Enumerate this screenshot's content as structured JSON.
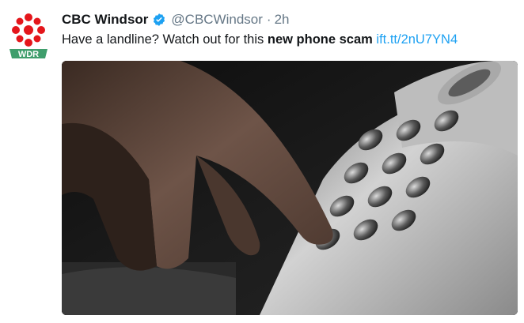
{
  "tweet": {
    "display_name": "CBC Windsor",
    "handle": "@CBCWindsor",
    "separator": "·",
    "time": "2h",
    "text_plain": "Have a landline? Watch out for this ",
    "text_bold": "new phone scam",
    "text_space": " ",
    "link": "ift.tt/2nU7YN4",
    "avatar_label": "WDR",
    "verified": true
  },
  "photo": {
    "subject": "finger-dialing-desk-phone",
    "key_count": 12
  },
  "colors": {
    "link": "#1da1f2",
    "verified": "#1da1f2",
    "name": "#14171a",
    "meta": "#657786",
    "cbc_red": "#e4161b",
    "wdr_green": "#3f9e6c"
  }
}
